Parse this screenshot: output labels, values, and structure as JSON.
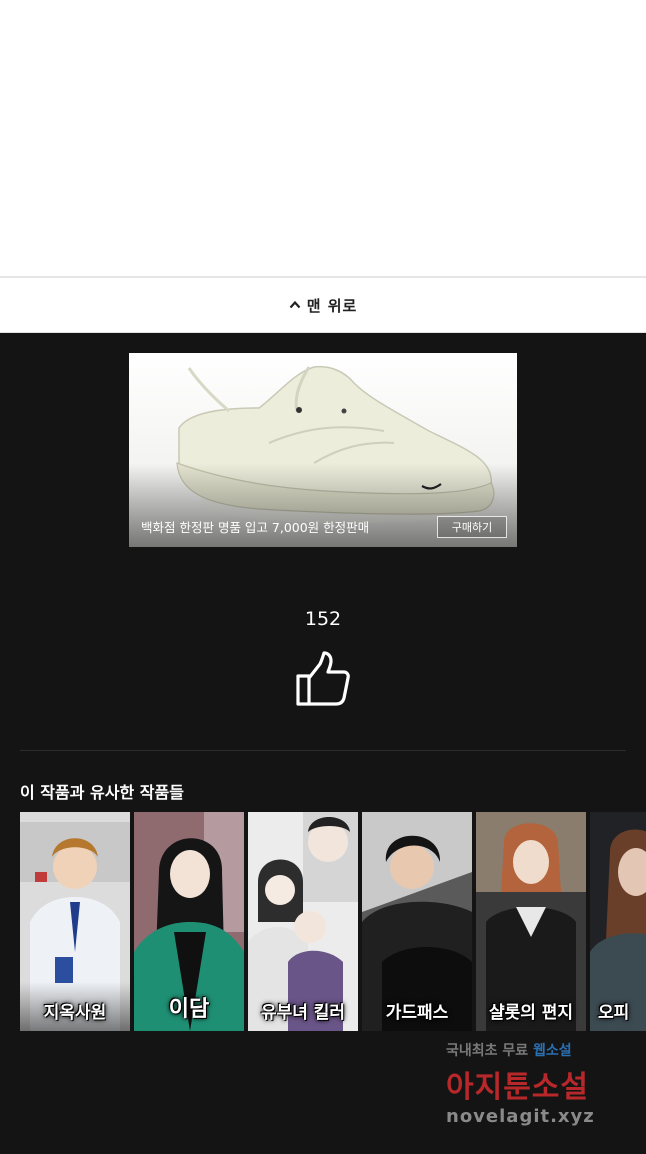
{
  "back_to_top": {
    "label": "맨 위로"
  },
  "ad": {
    "caption": "백화점 한정판 명품 입고 7,000원 한정판매",
    "button_label": "구매하기"
  },
  "likes": {
    "count": "152"
  },
  "similar": {
    "title": "이 작품과 유사한 작품들",
    "items": [
      {
        "title": "지옥사원"
      },
      {
        "title": "이담"
      },
      {
        "title": "유부녀 킬러"
      },
      {
        "title": "가드패스"
      },
      {
        "title": "샬롯의 편지"
      },
      {
        "title": "오피"
      }
    ]
  },
  "watermark": {
    "line1_prefix": "국내최초 무료 ",
    "line1_accent": "웹소설",
    "line2": "아지툰소설",
    "line3": "novelagit.xyz"
  },
  "colors": {
    "background": "#141414",
    "watermark_red": "#b8282a",
    "watermark_blue": "#2a6fb0"
  }
}
